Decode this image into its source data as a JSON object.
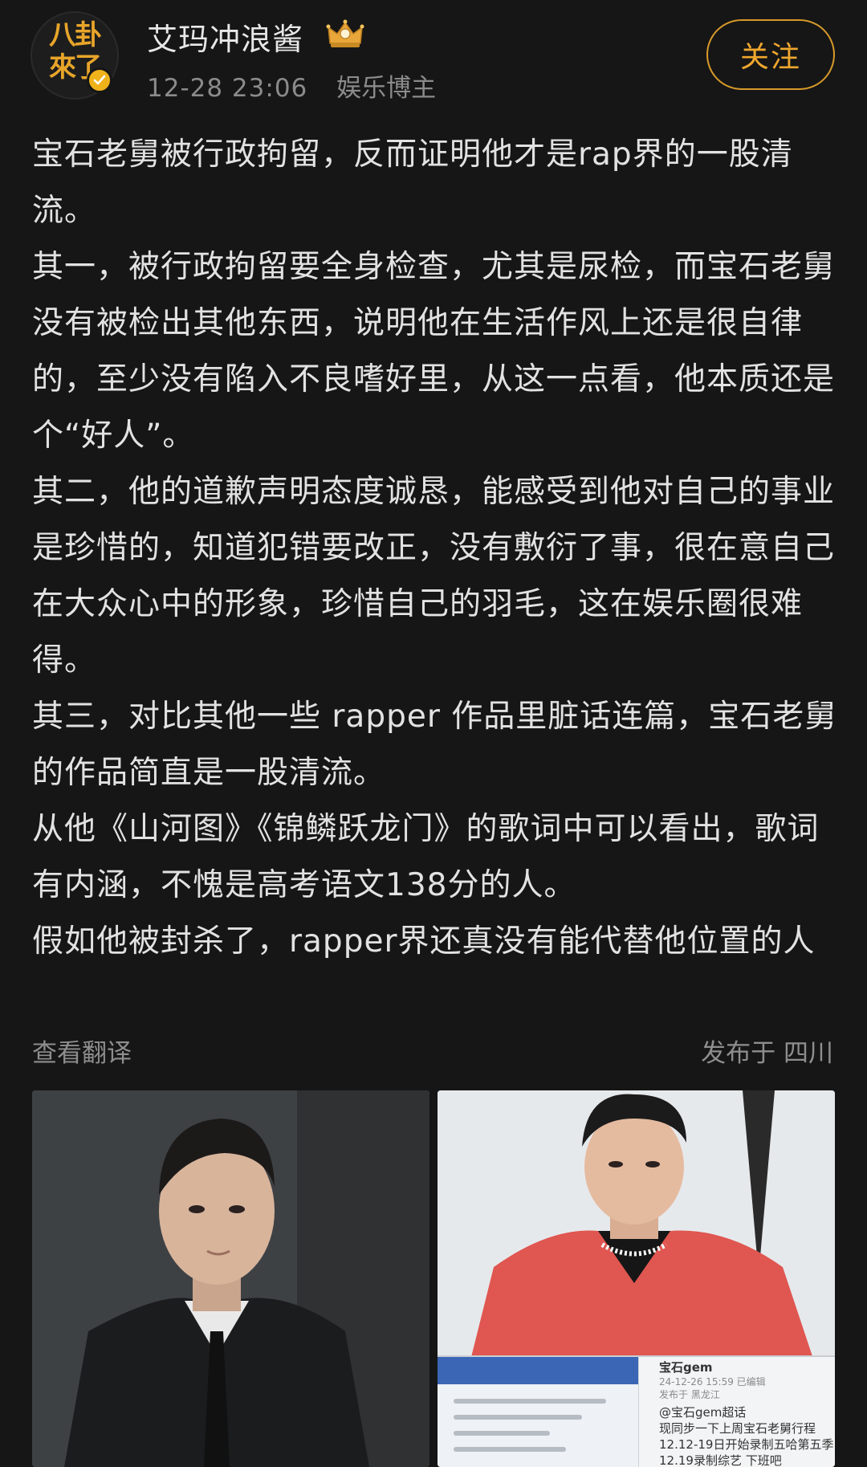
{
  "user": {
    "name": "艾玛冲浪酱",
    "avatar_text_line1": "八卦",
    "avatar_text_line2": "來了",
    "timestamp": "12-28 23:06",
    "role": "娱乐博主",
    "verified": true,
    "crown_icon": "crown-icon",
    "accent_color": "#f0a72e"
  },
  "actions": {
    "follow_label": "关注"
  },
  "post": {
    "paragraphs": [
      "宝石老舅被行政拘留，反而证明他才是rap界的一股清流。",
      "其一，被行政拘留要全身检查，尤其是尿检，而宝石老舅没有被检出其他东西，说明他在生活作风上还是很自律的，至少没有陷入不良嗜好里，从这一点看，他本质还是个“好人”。",
      "其二，他的道歉声明态度诚恳，能感受到他对自己的事业是珍惜的，知道犯错要改正，没有敷衍了事，很在意自己在大众心中的形象，珍惜自己的羽毛，这在娱乐圈很难得。",
      "其三，对比其他一些 rapper 作品里脏话连篇，宝石老舅的作品简直是一股清流。",
      "从他《山河图》《锦鳞跃龙门》的歌词中可以看出，歌词有内涵，不愧是高考语文138分的人。",
      "假如他被封杀了，rapper界还真没有能代替他位置的人"
    ]
  },
  "footer": {
    "view_translation": "查看翻译",
    "location": "发布于 四川"
  },
  "images": {
    "right_screenshot": {
      "account": "宝石gem",
      "date_line": "24-12-26 15:59  已编辑",
      "from_line": "发布于 黑龙江",
      "line1": "@宝石gem超话",
      "line2": "现同步一下上周宝石老舅行程",
      "line3": "12.12-19日开始录制五哈第五季",
      "line4": "12.19录制综艺 下班吧"
    }
  }
}
